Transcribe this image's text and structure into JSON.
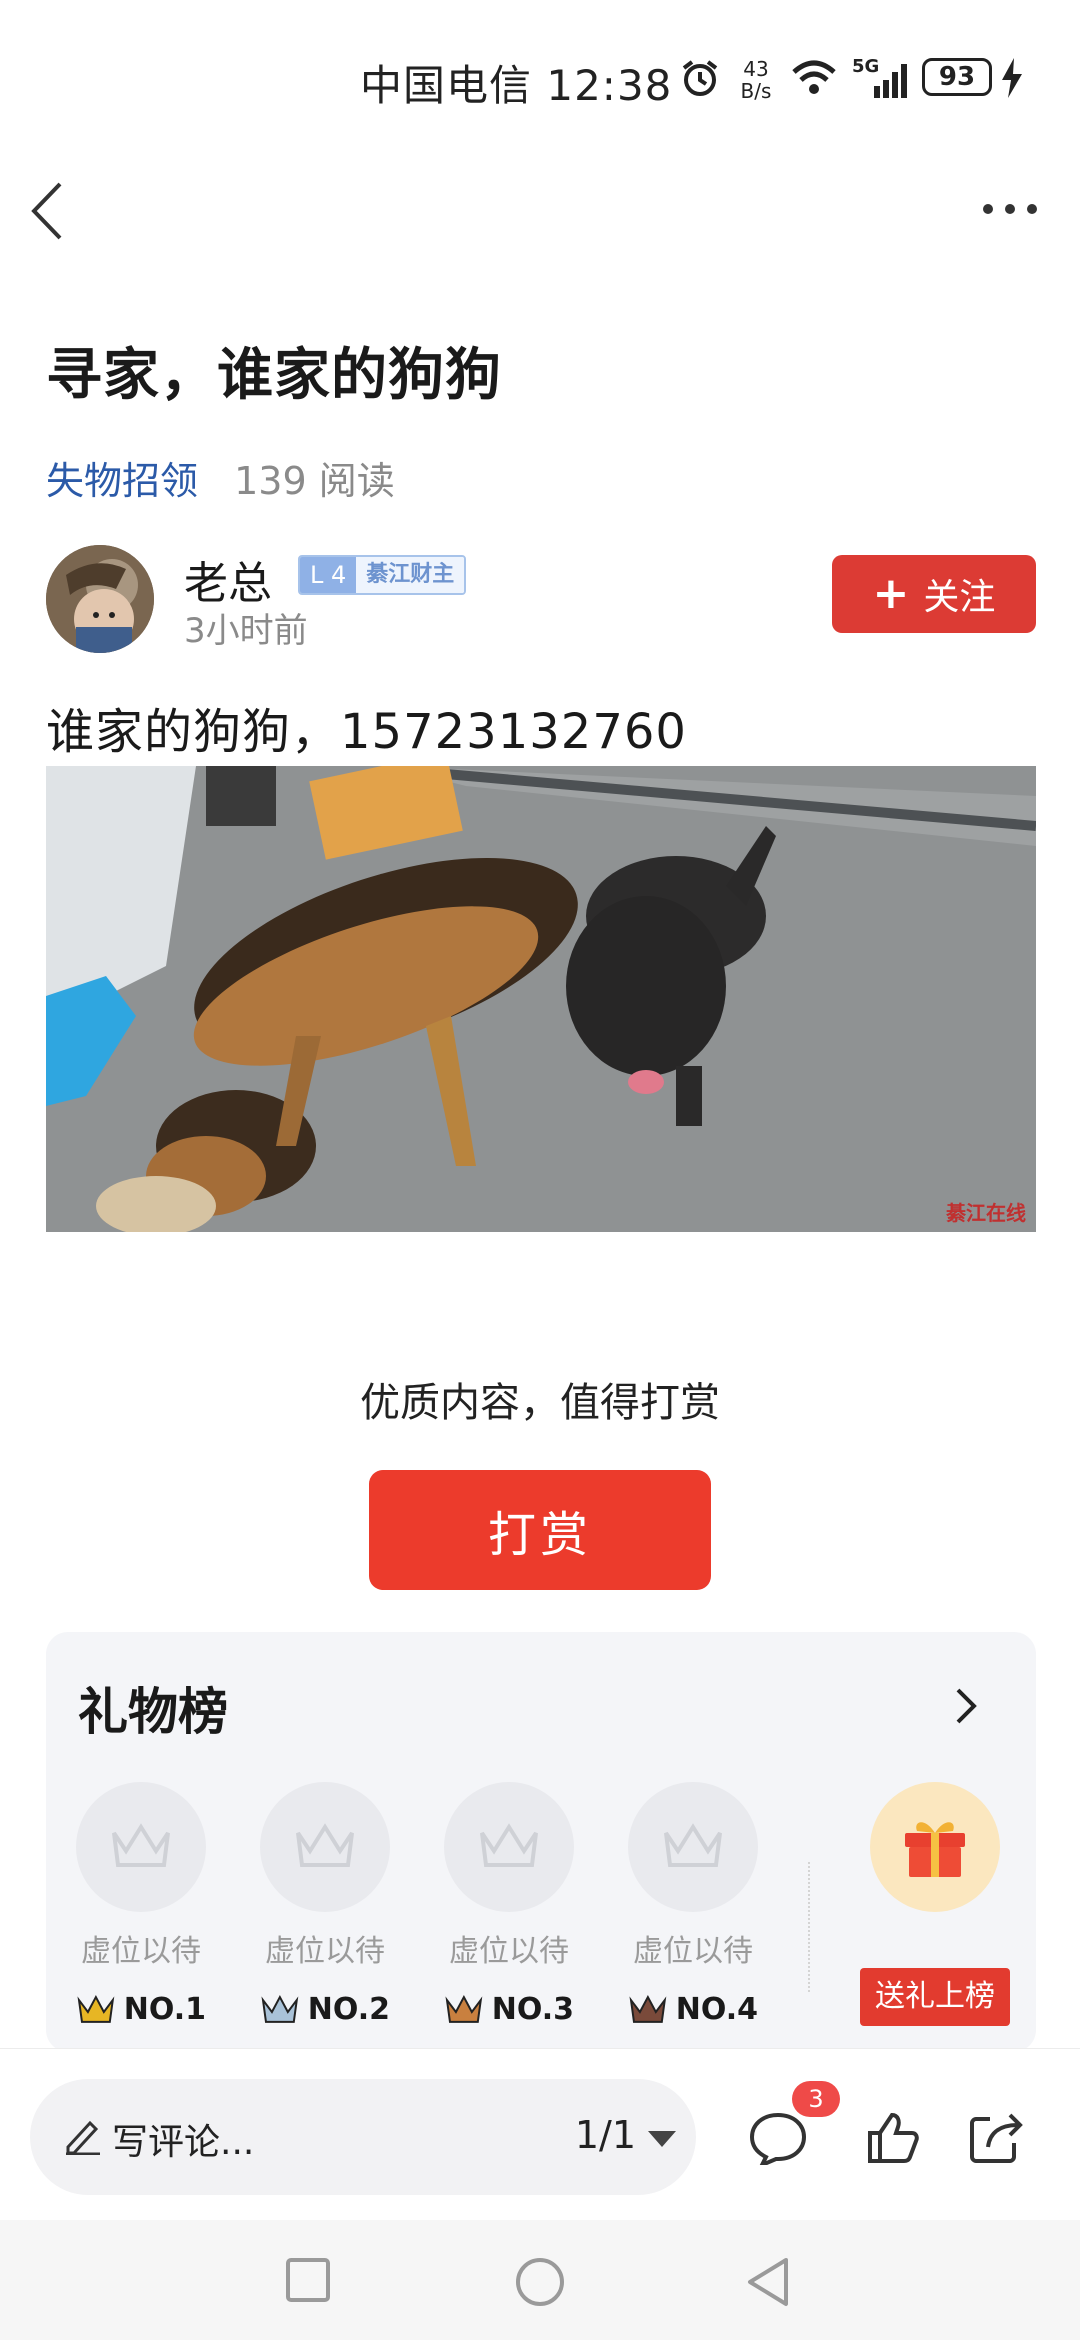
{
  "status_bar": {
    "carrier_time": "中国电信 12:38",
    "net_speed_value": "43",
    "net_speed_unit": "B/s",
    "battery": "93",
    "signal_label": "5G"
  },
  "article": {
    "title": "寻家，谁家的狗狗",
    "category": "失物招领",
    "reads": "139 阅读",
    "content": "谁家的狗狗，15723132760",
    "watermark": "綦江在线"
  },
  "author": {
    "name": "老总",
    "level": "L 4",
    "rank_title": "綦江财主",
    "time": "3小时前",
    "follow_label": "关注"
  },
  "reward": {
    "tip": "优质内容，值得打赏",
    "button_label": "打赏"
  },
  "gift_board": {
    "title": "礼物榜",
    "slots": [
      {
        "label": "虚位以待",
        "rank": "NO.1",
        "crown_color": "#e7b624"
      },
      {
        "label": "虚位以待",
        "rank": "NO.2",
        "crown_color": "#a9c2d8"
      },
      {
        "label": "虚位以待",
        "rank": "NO.3",
        "crown_color": "#c9803f"
      },
      {
        "label": "虚位以待",
        "rank": "NO.4",
        "crown_color": "#7a4a3a"
      }
    ],
    "send_label": "送礼上榜"
  },
  "bottom_bar": {
    "comment_placeholder": "写评论...",
    "page_indicator": "1/1",
    "comment_count": "3"
  },
  "colors": {
    "accent_red": "#dc3b34",
    "reward_red": "#ec3b2c",
    "link_blue": "#2b5aa8"
  }
}
